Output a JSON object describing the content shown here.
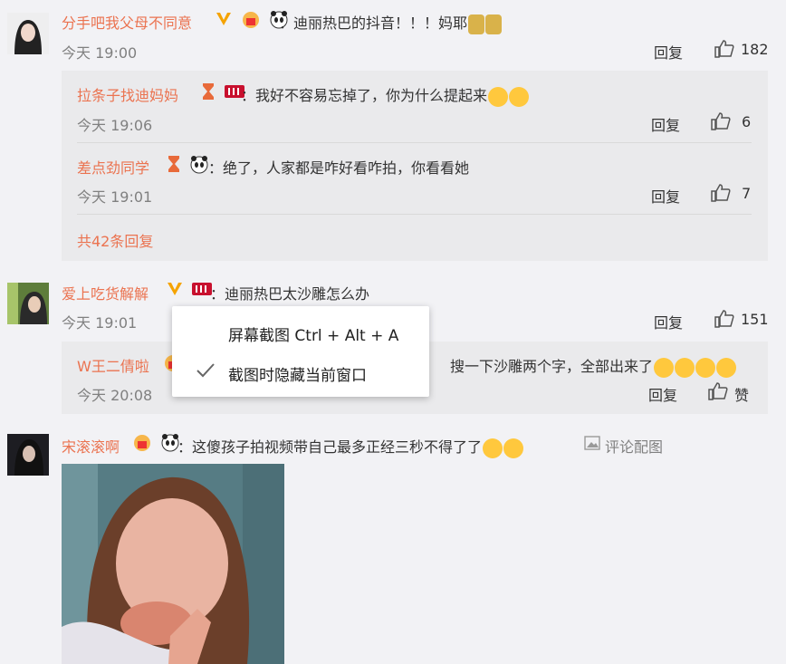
{
  "comments": [
    {
      "name": "分手吧我父母不同意",
      "text": "：迪丽热巴的抖音！！！妈耶",
      "time": "今天 19:00",
      "reply_label": "回复",
      "likes": "182",
      "replies": [
        {
          "name": "拉条子找迪妈妈",
          "text": "：我好不容易忘掉了，你为什么提起来",
          "time": "今天 19:06",
          "reply_label": "回复",
          "likes": "6"
        },
        {
          "name": "差点劲同学",
          "text": "：绝了，人家都是咋好看咋拍，你看看她",
          "time": "今天 19:01",
          "reply_label": "回复",
          "likes": "7"
        }
      ],
      "view_more": "共42条回复"
    },
    {
      "name": "爱上吃货解解",
      "text": "：迪丽热巴太沙雕怎么办",
      "time": "今天 19:01",
      "reply_label": "回复",
      "likes": "151",
      "replies": [
        {
          "name": "W王二倩啦",
          "text_visible": "搜一下沙雕两个字，全部出来了",
          "time": "今天 20:08",
          "reply_label": "回复",
          "likes": "赞"
        }
      ]
    },
    {
      "name": "宋滚滚啊",
      "text": "：这傻孩子拍视频带自己最多正经三秒不得了了",
      "pic_label": "评论配图"
    }
  ],
  "context_menu": {
    "item1": "屏幕截图 Ctrl + Alt + A",
    "item2": "截图时隐藏当前窗口",
    "item2_checked": true
  },
  "colors": {
    "name": "#eb7350",
    "background": "#f2f2f5",
    "reply_bg": "#eaeaec"
  }
}
